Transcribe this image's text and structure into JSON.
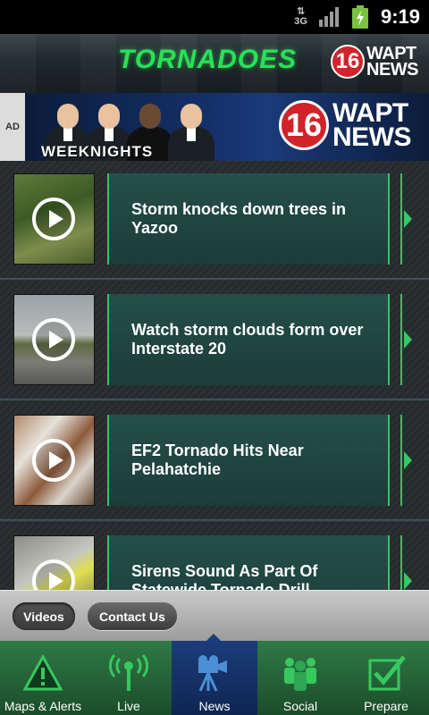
{
  "status_bar": {
    "network": "3G",
    "time": "9:19"
  },
  "header": {
    "title": "TORNADOES",
    "logo_number": "16",
    "logo_line1": "WAPT",
    "logo_line2": "NEWS"
  },
  "ad": {
    "tag": "AD",
    "tagline": "WEEKNIGHTS",
    "logo_number": "16",
    "logo_line1": "WAPT",
    "logo_line2": "NEWS"
  },
  "videos": [
    {
      "title": "Storm knocks down trees in Yazoo"
    },
    {
      "title": "Watch storm clouds form over Interstate 20"
    },
    {
      "title": "EF2 Tornado Hits Near Pelahatchie"
    },
    {
      "title": "Sirens Sound As Part Of Statewide Tornado Drill"
    }
  ],
  "segments": {
    "videos": "Videos",
    "contact": "Contact Us"
  },
  "tabs": [
    {
      "label": "Maps & Alerts",
      "icon": "warning-icon"
    },
    {
      "label": "Live",
      "icon": "antenna-icon"
    },
    {
      "label": "News",
      "icon": "camera-icon",
      "active": true
    },
    {
      "label": "Social",
      "icon": "people-icon"
    },
    {
      "label": "Prepare",
      "icon": "checkbox-icon"
    }
  ],
  "colors": {
    "accent_green": "#29e05a",
    "panel": "#244f49",
    "tab_active": "#1b3d7a",
    "logo_red": "#d2232a"
  }
}
